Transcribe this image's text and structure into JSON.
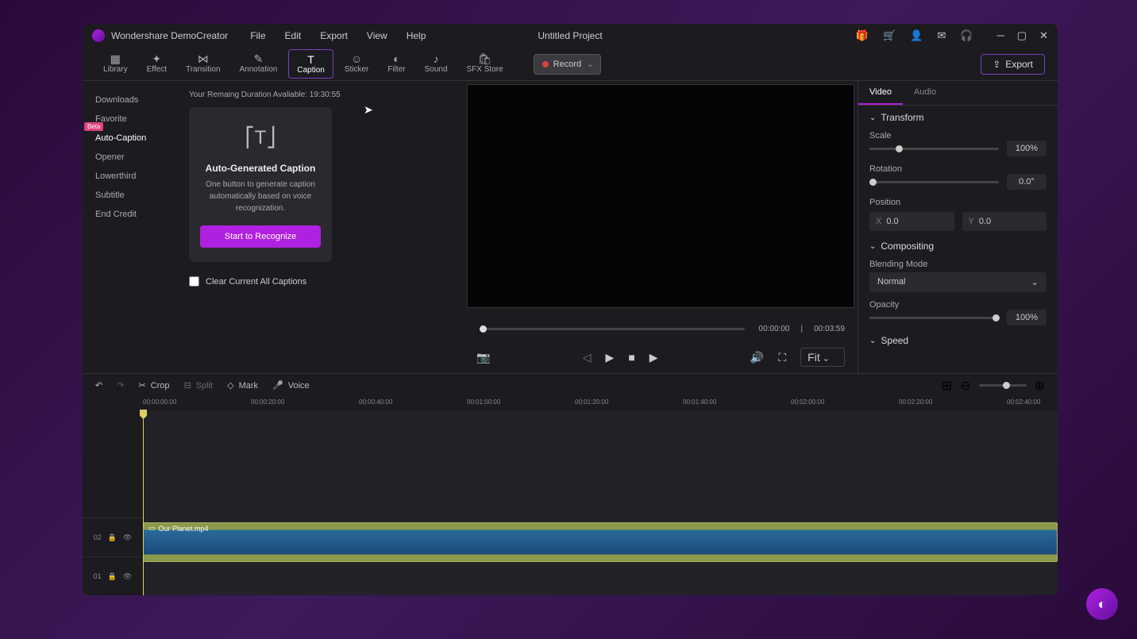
{
  "app_name": "Wondershare DemoCreator",
  "project_title": "Untitled Project",
  "menus": [
    "File",
    "Edit",
    "Export",
    "View",
    "Help"
  ],
  "ribbon": [
    {
      "label": "Library"
    },
    {
      "label": "Effect"
    },
    {
      "label": "Transition"
    },
    {
      "label": "Annotation"
    },
    {
      "label": "Caption",
      "active": true
    },
    {
      "label": "Sticker"
    },
    {
      "label": "Filter"
    },
    {
      "label": "Sound"
    },
    {
      "label": "SFX Store"
    }
  ],
  "record_label": "Record",
  "export_label": "Export",
  "caption_nav": [
    "Downloads",
    "Favorite",
    "Auto-Caption",
    "Opener",
    "Lowerthird",
    "Subtitle",
    "End Credit"
  ],
  "caption_nav_active": 2,
  "beta_badge": "Beta",
  "remaining": "Your Remaing Duration Avaliable: 19:30:55",
  "caption_card": {
    "title": "Auto-Generated Caption",
    "desc": "One button to generate caption automatically based on voice recognization.",
    "button": "Start to Recognize"
  },
  "clear_captions": "Clear Current All Captions",
  "preview": {
    "current": "00:00:00",
    "total": "00:03:59",
    "fit": "Fit"
  },
  "right_tabs": [
    "Video",
    "Audio"
  ],
  "right_active": 0,
  "transform": {
    "heading": "Transform",
    "scale_label": "Scale",
    "scale": "100%",
    "rotation_label": "Rotation",
    "rotation": "0.0°",
    "position_label": "Position",
    "x": "0.0",
    "y": "0.0"
  },
  "compositing": {
    "heading": "Compositing",
    "blend_label": "Blending Mode",
    "blend": "Normal",
    "opacity_label": "Opacity",
    "opacity": "100%"
  },
  "speed": {
    "heading": "Speed"
  },
  "tl_tools": [
    "Crop",
    "Split",
    "Mark",
    "Voice"
  ],
  "ruler": [
    "00:00:00:00",
    "00:00:20:00",
    "00:00:40:00",
    "00:01:00:00",
    "00:01:20:00",
    "00:01:40:00",
    "00:02:00:00",
    "00:02:20:00",
    "00:02:40:00"
  ],
  "clip_name": "Our Planet.mp4",
  "tracks": [
    "02",
    "01"
  ]
}
